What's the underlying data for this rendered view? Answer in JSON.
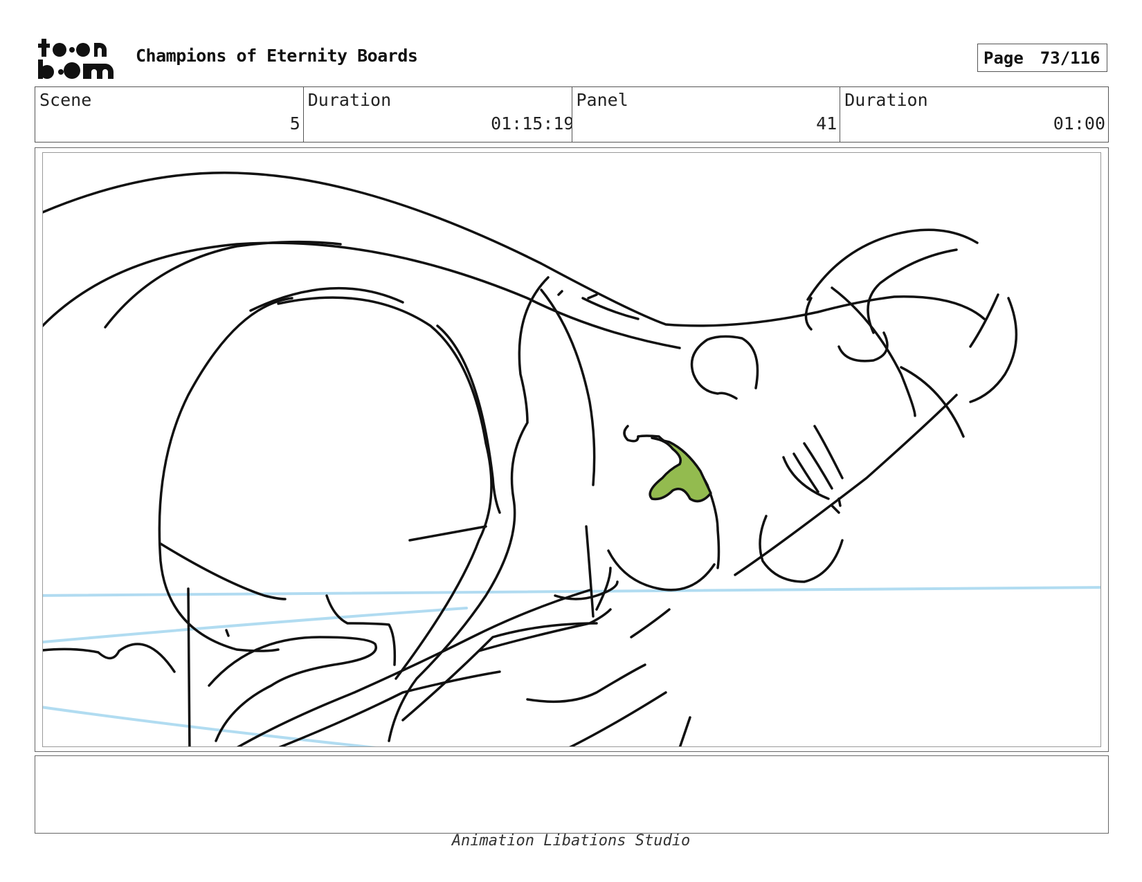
{
  "header": {
    "logo_text_line1": "toon",
    "logo_text_line2": "boom",
    "title": "Champions of Eternity Boards",
    "page_label": "Page",
    "page_number": "73/116"
  },
  "info": {
    "scene_label": "Scene",
    "scene_value": "5",
    "scene_duration_label": "Duration",
    "scene_duration_value": "01:15:19",
    "panel_label": "Panel",
    "panel_value": "41",
    "panel_duration_label": "Duration",
    "panel_duration_value": "01:00"
  },
  "panel": {
    "line_color": "#111111",
    "guide_color": "#a9d8f0",
    "tongue_color": "#93bb4f"
  },
  "notes": {
    "text": ""
  },
  "footer": {
    "studio": "Animation Libations Studio"
  }
}
